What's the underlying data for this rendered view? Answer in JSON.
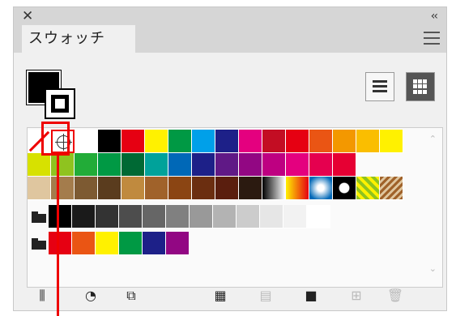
{
  "panel": {
    "close_glyph": "✕",
    "collapse_glyph": "‹‹",
    "tab_title": "スウォッチ"
  },
  "toolbar_icons": [
    "swatch-libraries-icon",
    "swatch-kind-icon",
    "swatch-options-icon",
    "new-color-group-icon",
    "swatch-library-menu-icon",
    "new-swatch-icon",
    "delete-swatch-icon"
  ],
  "rows": {
    "row1": [
      "#ffffff",
      "#000000",
      "#e60012",
      "#fff100",
      "#009944",
      "#00a0e9",
      "#1d2088",
      "#e4007f",
      "#c30d23",
      "#e60012",
      "#ea5514",
      "#f39800",
      "#fabe00",
      "#fff100"
    ],
    "row2": [
      "#d7e100",
      "#8fc31f",
      "#22ac38",
      "#009944",
      "#006934",
      "#00a29a",
      "#0068b7",
      "#1d2088",
      "#601986",
      "#920783",
      "#be0081",
      "#e4007f",
      "#e5004f",
      "#e60033"
    ],
    "row3": [
      "#dfc69f",
      "#a47c4c",
      "#7d5a32",
      "#5a3c1e",
      "#c08a3e",
      "#a0622a",
      "#8b4513",
      "#6b2e10",
      "#5a1e0e",
      "#2b1a10"
    ],
    "row4": [
      "#000000",
      "#1a1a1a",
      "#333333",
      "#4d4d4d",
      "#666666",
      "#808080",
      "#999999",
      "#b3b3b3",
      "#cccccc",
      "#e6e6e6",
      "#f2f2f2",
      "#ffffff"
    ],
    "row5": [
      "#e60012",
      "#ea5514",
      "#fff100",
      "#009944",
      "#1d2088",
      "#920783"
    ]
  }
}
